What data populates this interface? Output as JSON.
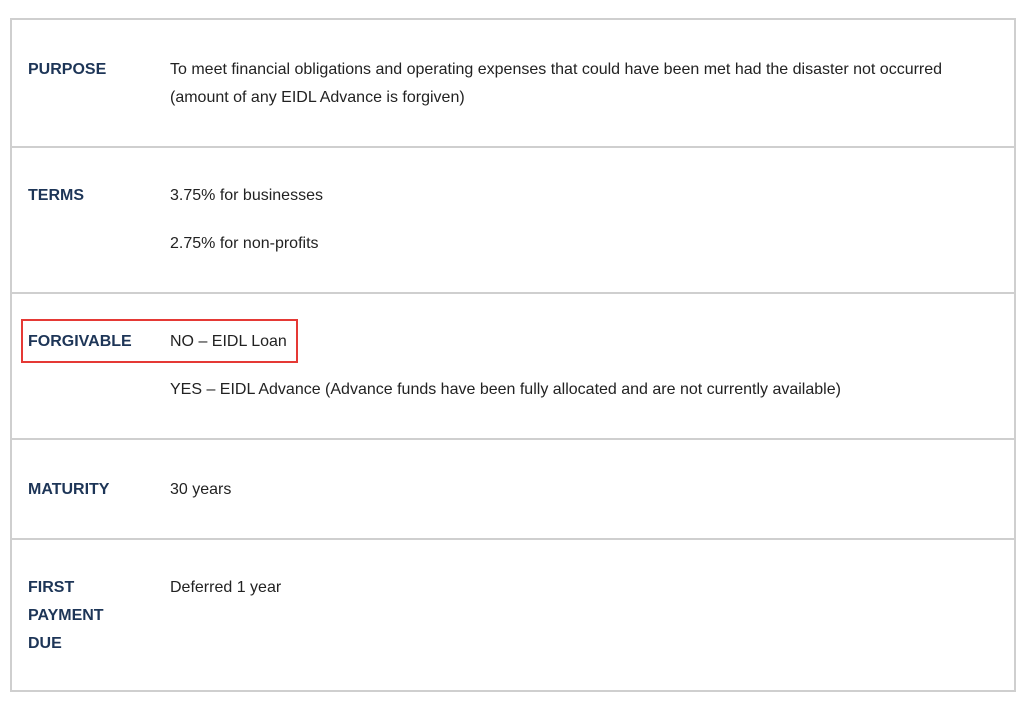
{
  "rows": [
    {
      "label_lines": [
        "PURPOSE"
      ],
      "values": [
        "To meet financial obligations and operating expenses that could have been met had the disaster not occurred (amount of any EIDL Advance is forgiven)"
      ]
    },
    {
      "label_lines": [
        "TERMS"
      ],
      "values": [
        "3.75% for businesses",
        "2.75% for non-profits"
      ]
    },
    {
      "label_lines": [
        "FORGIVABLE"
      ],
      "values": [
        "NO – EIDL Loan",
        "YES – EIDL Advance (Advance funds have been fully allocated and are not currently available)"
      ]
    },
    {
      "label_lines": [
        "MATURITY"
      ],
      "values": [
        "30 years"
      ]
    },
    {
      "label_lines": [
        "FIRST",
        "PAYMENT",
        "DUE"
      ],
      "values": [
        "Deferred 1 year"
      ]
    }
  ],
  "highlight": {
    "row": 2,
    "color": "#e53935"
  },
  "colors": {
    "label": "#1d3557",
    "text": "#222222",
    "border": "#cfcfcf"
  }
}
